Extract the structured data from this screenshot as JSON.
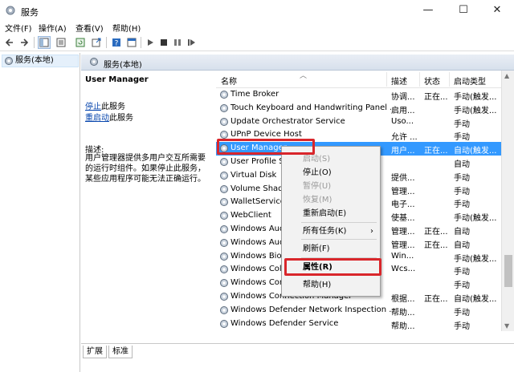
{
  "window": {
    "title": "服务",
    "minimize": "—",
    "maximize": "☐",
    "close": "✕"
  },
  "menu": [
    "文件(F)",
    "操作(A)",
    "查看(V)",
    "帮助(H)"
  ],
  "tree": {
    "root": "服务(本地)"
  },
  "panel": {
    "header": "服务(本地)"
  },
  "details": {
    "service_name": "User Manager",
    "stop_link": "停止",
    "stop_suffix": "此服务",
    "restart_link": "重启动",
    "restart_suffix": "此服务",
    "desc_label": "描述:",
    "desc_text": "用户管理器提供多用户交互所需要的运行时组件。如果停止此服务，某些应用程序可能无法正确运行。"
  },
  "table": {
    "columns": {
      "name": "名称",
      "desc": "描述",
      "status": "状态",
      "startup": "启动类型"
    },
    "rows": [
      {
        "name": "Time Broker",
        "desc": "协调...",
        "status": "正在...",
        "startup": "手动(触发..."
      },
      {
        "name": "Touch Keyboard and Handwriting Panel ...",
        "desc": "启用...",
        "status": "",
        "startup": "手动(触发..."
      },
      {
        "name": "Update Orchestrator Service",
        "desc": "Uso...",
        "status": "",
        "startup": "手动"
      },
      {
        "name": "UPnP Device Host",
        "desc": "允许 ...",
        "status": "",
        "startup": "手动"
      },
      {
        "name": "User Manager",
        "desc": "用户...",
        "status": "正在...",
        "startup": "自动(触发..."
      },
      {
        "name": "User Profile S",
        "desc": "",
        "status": "",
        "startup": "自动"
      },
      {
        "name": "Virtual Disk",
        "desc": "提供...",
        "status": "",
        "startup": "手动"
      },
      {
        "name": "Volume Shado",
        "desc": "管理...",
        "status": "",
        "startup": "手动"
      },
      {
        "name": "WalletService",
        "desc": "电子...",
        "status": "",
        "startup": "手动"
      },
      {
        "name": "WebClient",
        "desc": "使基...",
        "status": "",
        "startup": "手动(触发..."
      },
      {
        "name": "Windows Aud",
        "desc": "管理...",
        "status": "正在...",
        "startup": "自动"
      },
      {
        "name": "Windows Aud",
        "desc": "管理...",
        "status": "正在...",
        "startup": "自动"
      },
      {
        "name": "Windows Bio",
        "desc": "Win...",
        "status": "",
        "startup": "手动(触发..."
      },
      {
        "name": "Windows Col",
        "desc": "Wcs...",
        "status": "",
        "startup": "手动"
      },
      {
        "name": "Windows Con",
        "desc": "",
        "status": "",
        "startup": "手动"
      },
      {
        "name": "Windows Connection Manager",
        "desc": "根据...",
        "status": "正在...",
        "startup": "自动(触发..."
      },
      {
        "name": "Windows Defender Network Inspection ...",
        "desc": "帮助...",
        "status": "",
        "startup": "手动"
      },
      {
        "name": "Windows Defender Service",
        "desc": "帮助...",
        "status": "",
        "startup": "手动"
      }
    ]
  },
  "context_menu": {
    "items": [
      {
        "label": "启动(S)",
        "disabled": true
      },
      {
        "label": "停止(O)",
        "disabled": false
      },
      {
        "label": "暂停(U)",
        "disabled": true
      },
      {
        "label": "恢复(M)",
        "disabled": true
      },
      {
        "label": "重新启动(E)",
        "disabled": false
      },
      {
        "label": "所有任务(K)",
        "disabled": false,
        "submenu": "›"
      },
      {
        "label": "刷新(F)",
        "disabled": false
      },
      {
        "label": "属性(R)",
        "disabled": false,
        "bold": true
      },
      {
        "label": "帮助(H)",
        "disabled": false
      }
    ]
  },
  "tabs": [
    "扩展",
    "标准"
  ],
  "colors": {
    "selection": "#3399ff",
    "highlight_box": "#d9262b",
    "link": "#0645ad"
  },
  "icons": [
    "services-app-icon",
    "back-arrow-icon",
    "forward-arrow-icon",
    "console-tree-icon",
    "list-view-icon",
    "refresh-icon",
    "export-icon",
    "help-icon",
    "properties-icon",
    "play-icon",
    "stop-icon",
    "pause-icon",
    "restart-icon",
    "gear-icon"
  ]
}
